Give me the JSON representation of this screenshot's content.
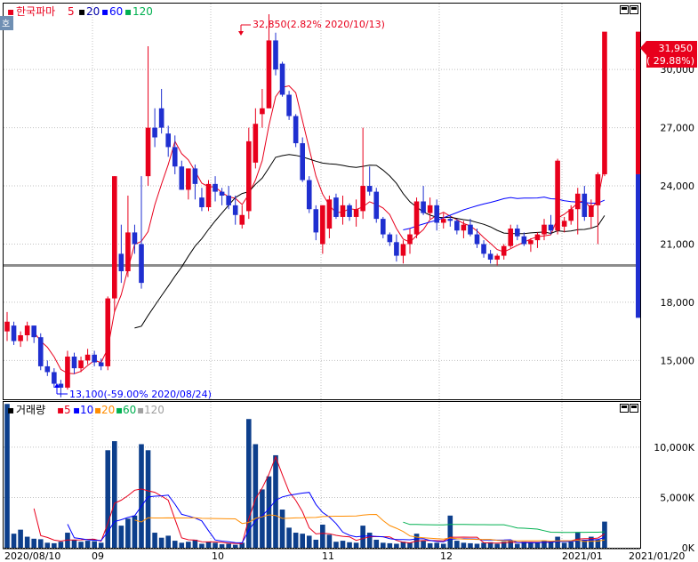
{
  "price_panel": {
    "legend_marker": "▪",
    "stock_name": "한국파마",
    "ma_periods": [
      {
        "label": "5",
        "color": "#e8001c"
      },
      {
        "label": "20",
        "color": "#000000"
      },
      {
        "label": "60",
        "color": "#0000ff"
      },
      {
        "label": "120",
        "color": "#00b050"
      }
    ],
    "y_ticks": [
      "30,000",
      "27,000",
      "24,000",
      "21,000",
      "18,000",
      "15,000"
    ],
    "y_tick_values": [
      30000,
      27000,
      24000,
      21000,
      18000,
      15000
    ],
    "ylim": [
      13000,
      33400
    ],
    "current_price": "31,950",
    "current_change": "( 29.88%)",
    "high_annotation": "32,850(2.82% 2020/10/13)",
    "low_annotation": "13,100(-59.00% 2020/08/24)",
    "horizontal_line_value": 19900
  },
  "volume_panel": {
    "legend_marker": "▪",
    "title": "거래량",
    "ma_periods": [
      {
        "label": "5",
        "color": "#e8001c"
      },
      {
        "label": "10",
        "color": "#0000ff"
      },
      {
        "label": "20",
        "color": "#ff8c00"
      },
      {
        "label": "60",
        "color": "#00b050"
      },
      {
        "label": "120",
        "color": "#a0a0a0"
      }
    ],
    "y_ticks": [
      "10,000K",
      "5,000K",
      "0K"
    ],
    "y_tick_values": [
      10000,
      5000,
      0
    ],
    "ylim": [
      0,
      14500
    ]
  },
  "x_axis": {
    "labels": [
      "2020/08/10",
      "09",
      "10",
      "11",
      "12",
      "2021/01",
      "2021/01/20"
    ]
  },
  "side_button": "호",
  "colors": {
    "up": "#e8001c",
    "down": "#1f2fd0",
    "volume": "#0d3f8c",
    "grid": "#c0c0c0",
    "hline": "#8c8c8c"
  },
  "chart_data": {
    "type": "candlestick",
    "candles_ohlc": [
      [
        16500,
        17500,
        16000,
        17000
      ],
      [
        16800,
        17000,
        15800,
        16000
      ],
      [
        16000,
        16500,
        15700,
        16300
      ],
      [
        16300,
        17000,
        16000,
        16800
      ],
      [
        16800,
        16800,
        15900,
        16200
      ],
      [
        16200,
        16400,
        14500,
        14700
      ],
      [
        14700,
        15000,
        14200,
        14400
      ],
      [
        14400,
        14600,
        13600,
        13800
      ],
      [
        13800,
        14000,
        13100,
        13600
      ],
      [
        13600,
        15500,
        13500,
        15200
      ],
      [
        15200,
        15400,
        14300,
        14600
      ],
      [
        14600,
        15200,
        14400,
        15000
      ],
      [
        15000,
        15600,
        14800,
        15300
      ],
      [
        15300,
        15500,
        14700,
        14900
      ],
      [
        14900,
        15100,
        14500,
        14700
      ],
      [
        14700,
        18300,
        14500,
        18200
      ],
      [
        18200,
        24500,
        17500,
        24500
      ],
      [
        20500,
        22000,
        19000,
        19600
      ],
      [
        19600,
        23500,
        19300,
        21600
      ],
      [
        21600,
        22000,
        20500,
        21000
      ],
      [
        21000,
        24500,
        18700,
        19000
      ],
      [
        24500,
        31200,
        24000,
        27000
      ],
      [
        27000,
        28000,
        26000,
        26500
      ],
      [
        28000,
        29000,
        26700,
        27000
      ],
      [
        26700,
        27100,
        25500,
        26000
      ],
      [
        26000,
        26600,
        24600,
        25000
      ],
      [
        25000,
        25300,
        23800,
        23800
      ],
      [
        23800,
        24900,
        23300,
        24900
      ],
      [
        24900,
        25100,
        23300,
        24100
      ],
      [
        23400,
        23900,
        22700,
        22900
      ],
      [
        22900,
        24300,
        22700,
        24100
      ],
      [
        24100,
        24500,
        23200,
        23700
      ],
      [
        23700,
        23900,
        23000,
        23500
      ],
      [
        23500,
        24000,
        22800,
        23000
      ],
      [
        23000,
        23500,
        22000,
        22500
      ],
      [
        22000,
        23000,
        21800,
        22500
      ],
      [
        22700,
        27000,
        22300,
        26300
      ],
      [
        25200,
        28000,
        24900,
        27200
      ],
      [
        27700,
        29000,
        27000,
        28000
      ],
      [
        28000,
        32850,
        28000,
        31500
      ],
      [
        31500,
        31900,
        29700,
        30000
      ],
      [
        30300,
        30400,
        28600,
        28700
      ],
      [
        28700,
        28900,
        27400,
        27600
      ],
      [
        27600,
        27700,
        26000,
        26200
      ],
      [
        26200,
        26500,
        24200,
        24300
      ],
      [
        24300,
        24500,
        22600,
        22800
      ],
      [
        22800,
        23000,
        21200,
        21600
      ],
      [
        21000,
        23000,
        20500,
        23000
      ],
      [
        21800,
        23500,
        21300,
        23300
      ],
      [
        23400,
        23600,
        22300,
        22400
      ],
      [
        22400,
        23500,
        22000,
        23000
      ],
      [
        23000,
        23100,
        22200,
        22400
      ],
      [
        22400,
        23300,
        21900,
        22800
      ],
      [
        22700,
        27000,
        22300,
        24000
      ],
      [
        24000,
        25000,
        23500,
        23700
      ],
      [
        23700,
        23900,
        22100,
        22300
      ],
      [
        22300,
        22400,
        21300,
        21500
      ],
      [
        21500,
        21600,
        20900,
        21100
      ],
      [
        21100,
        21500,
        20100,
        20400
      ],
      [
        20400,
        21200,
        20000,
        21000
      ],
      [
        21000,
        21800,
        20500,
        21500
      ],
      [
        21500,
        23400,
        21300,
        23200
      ],
      [
        23200,
        24000,
        22500,
        22600
      ],
      [
        22600,
        23400,
        22300,
        23000
      ],
      [
        23000,
        23300,
        21700,
        22100
      ],
      [
        22100,
        22600,
        21800,
        22300
      ],
      [
        22300,
        22500,
        21900,
        22200
      ],
      [
        22200,
        22300,
        21500,
        21700
      ],
      [
        21700,
        22200,
        21300,
        22000
      ],
      [
        22000,
        22300,
        21400,
        21500
      ],
      [
        21500,
        21800,
        20800,
        21000
      ],
      [
        21000,
        21200,
        20300,
        20500
      ],
      [
        20500,
        20700,
        20000,
        20200
      ],
      [
        20200,
        20500,
        19900,
        20400
      ],
      [
        20400,
        21000,
        20200,
        20900
      ],
      [
        20900,
        22000,
        20800,
        21800
      ],
      [
        21800,
        22000,
        21200,
        21400
      ],
      [
        21400,
        21600,
        20900,
        21000
      ],
      [
        21000,
        21300,
        20600,
        21200
      ],
      [
        21200,
        21600,
        20800,
        21500
      ],
      [
        21500,
        22300,
        21200,
        22000
      ],
      [
        22000,
        22500,
        21500,
        21700
      ],
      [
        21700,
        25400,
        21500,
        25300
      ],
      [
        21900,
        22400,
        21600,
        22200
      ],
      [
        22200,
        23000,
        22000,
        22800
      ],
      [
        22800,
        23900,
        21500,
        23600
      ],
      [
        23600,
        24000,
        22200,
        22400
      ],
      [
        22400,
        23300,
        21800,
        23000
      ],
      [
        23000,
        24700,
        21000,
        24600
      ],
      [
        24600,
        31900,
        24500,
        31950
      ]
    ],
    "volume_k": [
      14300,
      1400,
      1800,
      1100,
      900,
      850,
      500,
      450,
      600,
      1500,
      800,
      600,
      700,
      650,
      500,
      9700,
      10600,
      2200,
      2900,
      3200,
      10300,
      9700,
      1500,
      1000,
      1200,
      700,
      500,
      600,
      800,
      400,
      600,
      500,
      350,
      400,
      300,
      500,
      12800,
      10300,
      5800,
      7100,
      9200,
      3800,
      2000,
      1500,
      1400,
      1200,
      800,
      2300,
      1300,
      600,
      700,
      550,
      500,
      2200,
      1500,
      800,
      500,
      450,
      400,
      600,
      500,
      1400,
      700,
      450,
      500,
      400,
      3200,
      700,
      500,
      450,
      400,
      500,
      550,
      400,
      600,
      700,
      400,
      600,
      500,
      500,
      700,
      600,
      1100,
      500,
      600,
      1500,
      800,
      1100,
      800,
      2600
    ]
  }
}
